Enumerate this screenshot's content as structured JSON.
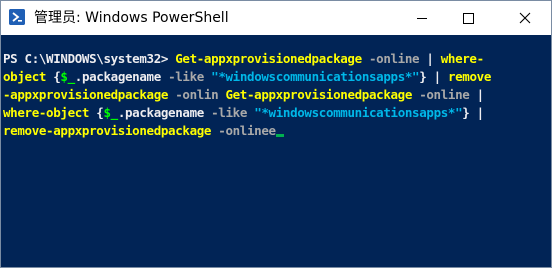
{
  "window": {
    "title": "管理员: Windows PowerShell",
    "icon": "powershell-icon",
    "controls": [
      "minimize-icon",
      "maximize-icon",
      "close-icon"
    ]
  },
  "colors": {
    "console_bg": "#012456",
    "default_text": "#eeedf0",
    "command": "#ffff00",
    "parameter": "#a9a9a9",
    "string": "#00b7e8",
    "variable": "#00ff00",
    "cursor": "#00b050"
  },
  "console": {
    "lines": [
      [
        {
          "type": "prompt",
          "text": "PS C:\\WINDOWS\\system32> "
        },
        {
          "type": "cmd",
          "text": "Get-appxprovisionedpackage"
        },
        {
          "type": "param",
          "text": " -online"
        },
        {
          "type": "pipe",
          "text": " | "
        },
        {
          "type": "cmd",
          "text": "where-"
        }
      ],
      [
        {
          "type": "cmd",
          "text": "object"
        },
        {
          "type": "brace",
          "text": " {"
        },
        {
          "type": "var",
          "text": "$_"
        },
        {
          "type": "prop",
          "text": ".packagename "
        },
        {
          "type": "param",
          "text": "-like "
        },
        {
          "type": "str",
          "text": "\"*windowscommunicationsapps*\""
        },
        {
          "type": "brace",
          "text": "}"
        },
        {
          "type": "pipe",
          "text": " | "
        },
        {
          "type": "cmd",
          "text": "remove"
        }
      ],
      [
        {
          "type": "cmd",
          "text": "-appxprovisionedpackage"
        },
        {
          "type": "param",
          "text": " -onlin "
        },
        {
          "type": "cmd",
          "text": "Get-appxprovisionedpackage"
        },
        {
          "type": "param",
          "text": " -online"
        },
        {
          "type": "pipe",
          "text": " |"
        }
      ],
      [
        {
          "type": "cmd",
          "text": "where-object"
        },
        {
          "type": "brace",
          "text": " {"
        },
        {
          "type": "var",
          "text": "$_"
        },
        {
          "type": "prop",
          "text": ".packagename "
        },
        {
          "type": "param",
          "text": "-like "
        },
        {
          "type": "str",
          "text": "\"*windowscommunicationsapps*\""
        },
        {
          "type": "brace",
          "text": "}"
        },
        {
          "type": "pipe",
          "text": " |"
        }
      ],
      [
        {
          "type": "cmd",
          "text": "remove-appxprovisionedpackage"
        },
        {
          "type": "param",
          "text": " -onlinee"
        }
      ]
    ]
  }
}
